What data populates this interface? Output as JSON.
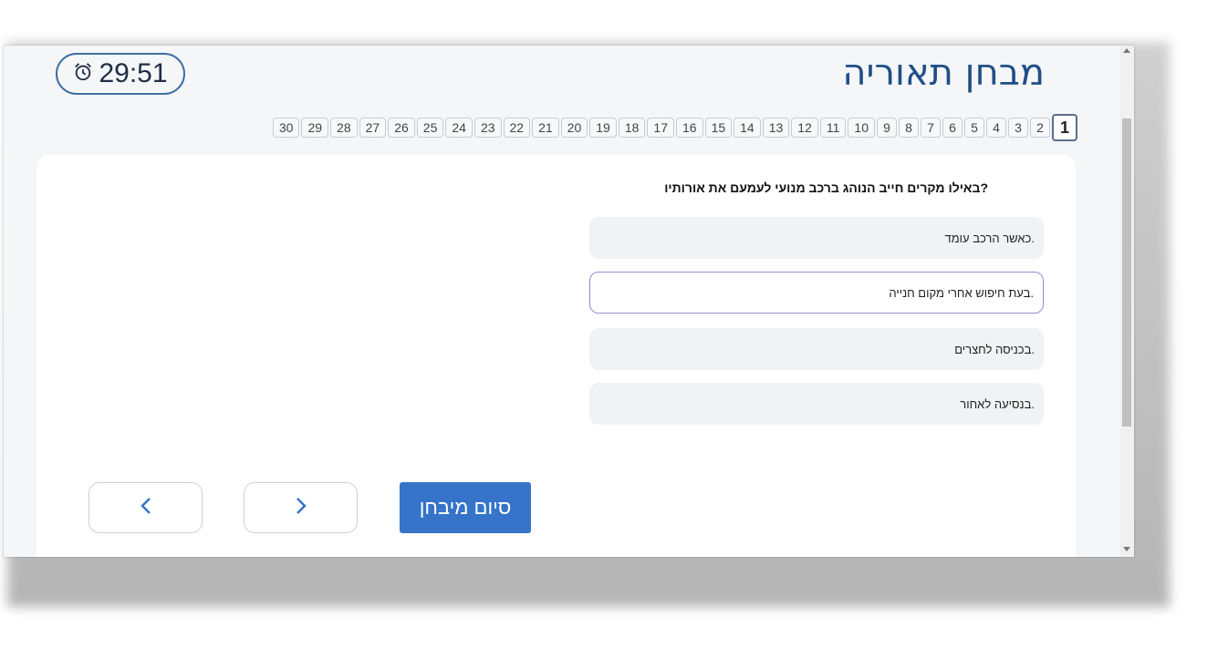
{
  "header": {
    "title": "מבחן תאוריה",
    "timer": "29:51",
    "timer_icon": "alarm-clock-icon"
  },
  "question_nav": {
    "active": 1,
    "numbers": [
      "1",
      "2",
      "3",
      "4",
      "5",
      "6",
      "7",
      "8",
      "9",
      "10",
      "11",
      "12",
      "13",
      "14",
      "15",
      "16",
      "17",
      "18",
      "19",
      "20",
      "21",
      "22",
      "23",
      "24",
      "25",
      "26",
      "27",
      "28",
      "29",
      "30"
    ]
  },
  "question": {
    "text": "?באילו מקרים חייב הנוהג ברכב מנועי לעמעם את אורותיו",
    "answers": [
      {
        "text": ".כאשר הרכב עומד",
        "selected": false
      },
      {
        "text": ".בעת חיפוש אחרי מקום חנייה",
        "selected": true
      },
      {
        "text": ".בכניסה לחצרים",
        "selected": false
      },
      {
        "text": ".בנסיעה לאחור",
        "selected": false
      }
    ]
  },
  "controls": {
    "finish_label": "סיום מיבחן",
    "prev_icon": "chevron-left-icon",
    "next_icon": "chevron-right-icon"
  },
  "colors": {
    "title": "#1f4f86",
    "finish_button": "#3574c8",
    "selected_border": "#8e8ed0"
  }
}
